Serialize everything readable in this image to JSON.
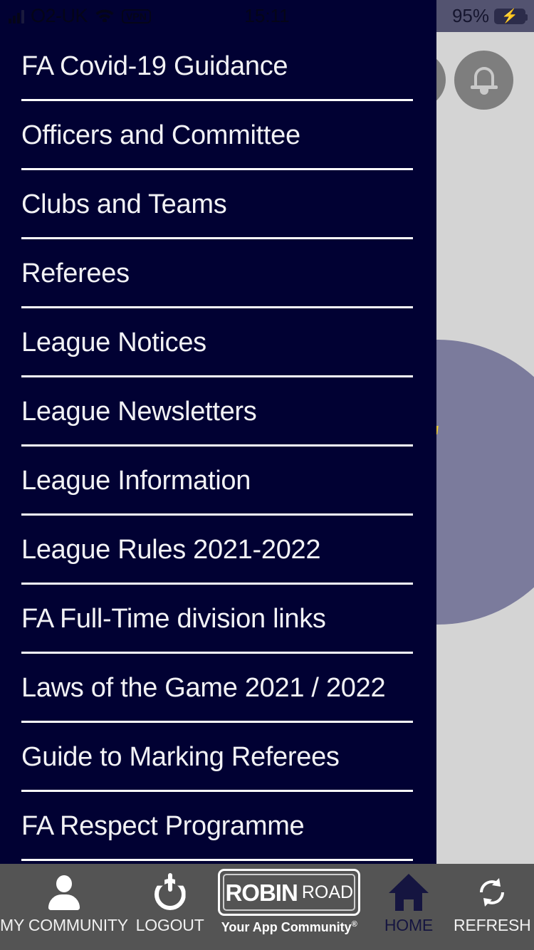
{
  "status_bar": {
    "carrier": "O2-UK",
    "vpn_label": "VPN",
    "time": "15:11",
    "battery_percent": "95%",
    "icons": [
      "signal-bars-icon",
      "wifi-icon",
      "vpn-badge-icon",
      "battery-charging-icon"
    ],
    "colors": {
      "left_bg": "#010133",
      "right_bg": "#535370",
      "battery_fill": "#3ad35a"
    }
  },
  "drawer": {
    "background": "#010133",
    "divider_color": "#ffffff",
    "items": [
      {
        "label": "FA Covid-19 Guidance"
      },
      {
        "label": "Officers and Committee"
      },
      {
        "label": "Clubs and Teams"
      },
      {
        "label": "Referees"
      },
      {
        "label": "League Notices"
      },
      {
        "label": "League Newsletters"
      },
      {
        "label": "League Information"
      },
      {
        "label": "League Rules 2021-2022"
      },
      {
        "label": "FA Full-Time division links"
      },
      {
        "label": "Laws of the Game 2021 / 2022"
      },
      {
        "label": "Guide to Marking Referees"
      },
      {
        "label": "FA Respect Programme"
      }
    ]
  },
  "page_behind": {
    "background": "#d4d4d4",
    "notification_button_icon": "bell-icon",
    "logo_circle_color": "#7b7b9c",
    "circle_button_color": "#7e7e7e"
  },
  "tab_bar": {
    "background": "#545454",
    "active_color": "#151540",
    "items": [
      {
        "label": "MY COMMUNITY",
        "icon": "person-icon",
        "active": false
      },
      {
        "label": "LOGOUT",
        "icon": "power-icon",
        "active": false
      },
      {
        "label": "HOME",
        "icon": "home-icon",
        "active": true
      },
      {
        "label": "REFRESH",
        "icon": "refresh-icon",
        "active": false
      }
    ],
    "brand": {
      "name_primary": "ROBIN",
      "name_secondary": "ROAD",
      "tagline": "Your App Community",
      "tagline_mark": "®"
    }
  }
}
